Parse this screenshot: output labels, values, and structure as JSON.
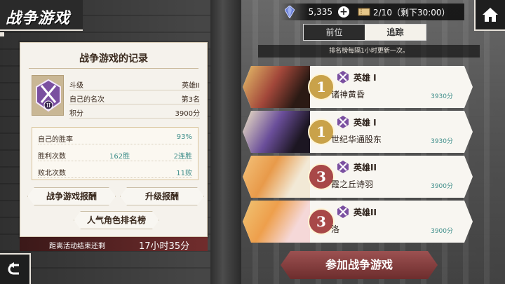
{
  "title": "战争游戏",
  "status": {
    "gems": "5,335",
    "plus": "+",
    "tickets": "2/10（剩下30:00）"
  },
  "tabs": [
    {
      "label": "前位",
      "active": false
    },
    {
      "label": "追踪",
      "active": true
    }
  ],
  "ranking_note": "排名榜每隔1小时更新一次。",
  "record": {
    "title": "战争游戏的记录",
    "rank_numeral": "II",
    "rows": [
      {
        "label": "斗级",
        "value": "英雄II"
      },
      {
        "label": "自己的名次",
        "value": "第3名"
      },
      {
        "label": "积分",
        "value": "3900分"
      }
    ],
    "stats": [
      {
        "label": "自己的胜率",
        "mid": "",
        "value": "93%"
      },
      {
        "label": "胜利次数",
        "mid": "162胜",
        "value": "2连胜"
      },
      {
        "label": "败北次数",
        "mid": "",
        "value": "11败"
      }
    ]
  },
  "buttons": {
    "reward": "战争游戏报酬",
    "upgrade_reward": "升级报酬",
    "popularity": "人气角色排名榜",
    "join": "参加战争游戏"
  },
  "end_bar": {
    "label": "距离活动结束还剩",
    "time": "17小时35分"
  },
  "rankings": [
    {
      "rank": "1",
      "tier": "英雄 I",
      "name": "诸神黄昏",
      "score": "3930分"
    },
    {
      "rank": "1",
      "tier": "英雄 I",
      "name": "世纪华通股东",
      "score": "3930分"
    },
    {
      "rank": "3",
      "tier": "英雄II",
      "name": "霞之丘诗羽",
      "score": "3900分"
    },
    {
      "rank": "3",
      "tier": "英雄II",
      "name": "洛",
      "score": "3900分"
    }
  ],
  "colors": {
    "accent_teal": "#3f8e8a",
    "gold": "#c9a24a",
    "join_red": "#8a3d3d"
  },
  "icons": [
    "gem-icon",
    "ticket-icon",
    "home-icon",
    "back-arrow-icon",
    "crossed-swords-icon"
  ]
}
